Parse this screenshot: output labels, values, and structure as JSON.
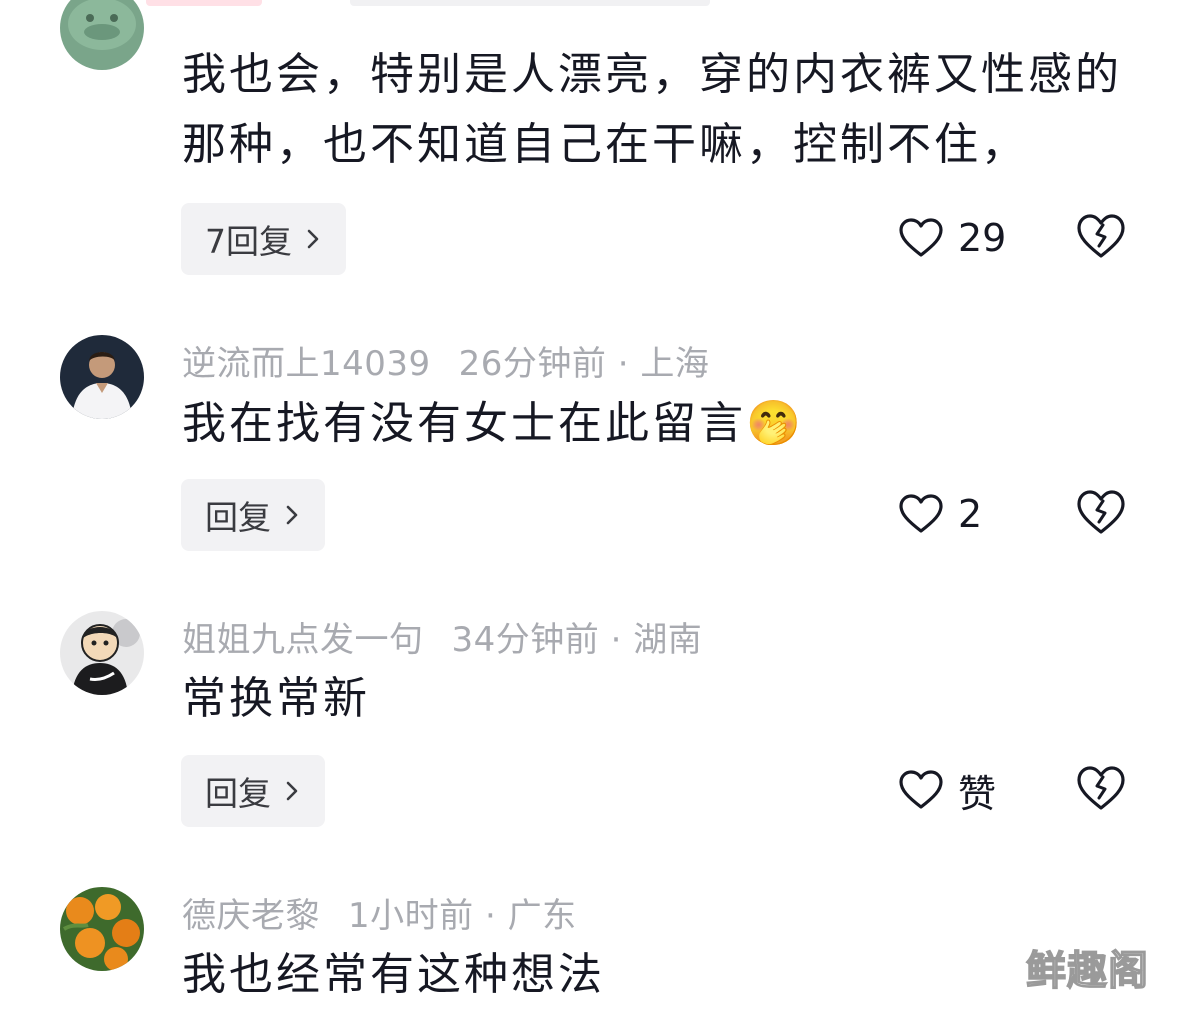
{
  "comments": [
    {
      "text": "我也会，特别是人漂亮，穿的内衣裤又性感的那种，也不知道自己在干嘛，控制不住，",
      "reply_label": "7回复",
      "like_count": "29"
    },
    {
      "username": "逆流而上14039",
      "time": "26分钟前",
      "location": "· 上海",
      "text": "我在找有没有女士在此留言",
      "emoji": "🤭",
      "reply_label": "回复",
      "like_count": "2"
    },
    {
      "username": "姐姐九点发一句",
      "time": "34分钟前",
      "location": "· 湖南",
      "text": "常换常新",
      "reply_label": "回复",
      "like_count": "赞"
    },
    {
      "username": "德庆老黎",
      "time": "1小时前",
      "location": "· 广东",
      "text": "我也经常有这种想法"
    }
  ],
  "watermark": "鲜趣阁",
  "colors": {
    "text": "#161823",
    "meta": "#a8aab0",
    "reply_bg": "#f2f2f4",
    "accent_stub": "#ff4d6a"
  },
  "icons": {
    "like": "heart-outline-icon",
    "dislike": "broken-heart-icon",
    "chevron": "chevron-right-icon"
  }
}
